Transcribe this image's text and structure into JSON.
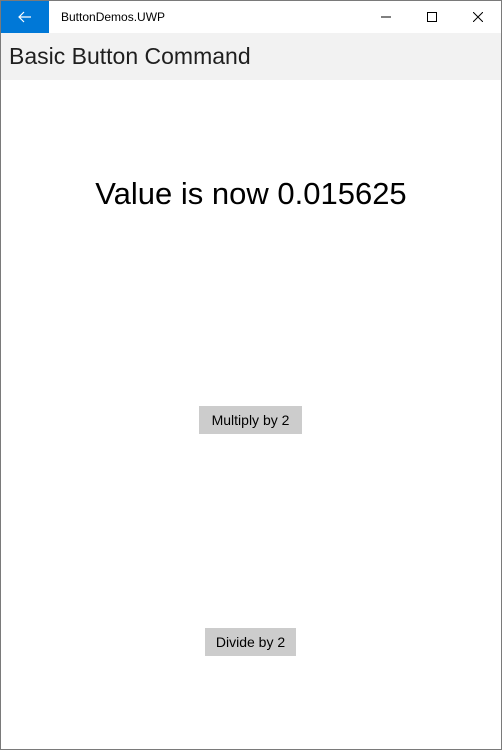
{
  "window": {
    "app_title": "ButtonDemos.UWP",
    "accent_color": "#0078d7"
  },
  "header": {
    "title": "Basic Button Command"
  },
  "content": {
    "value_text": "Value is now 0.015625",
    "multiply_label": "Multiply by 2",
    "divide_label": "Divide by 2"
  },
  "icons": {
    "back": "back-arrow-icon",
    "minimize": "minimize-icon",
    "maximize": "maximize-icon",
    "close": "close-icon"
  }
}
